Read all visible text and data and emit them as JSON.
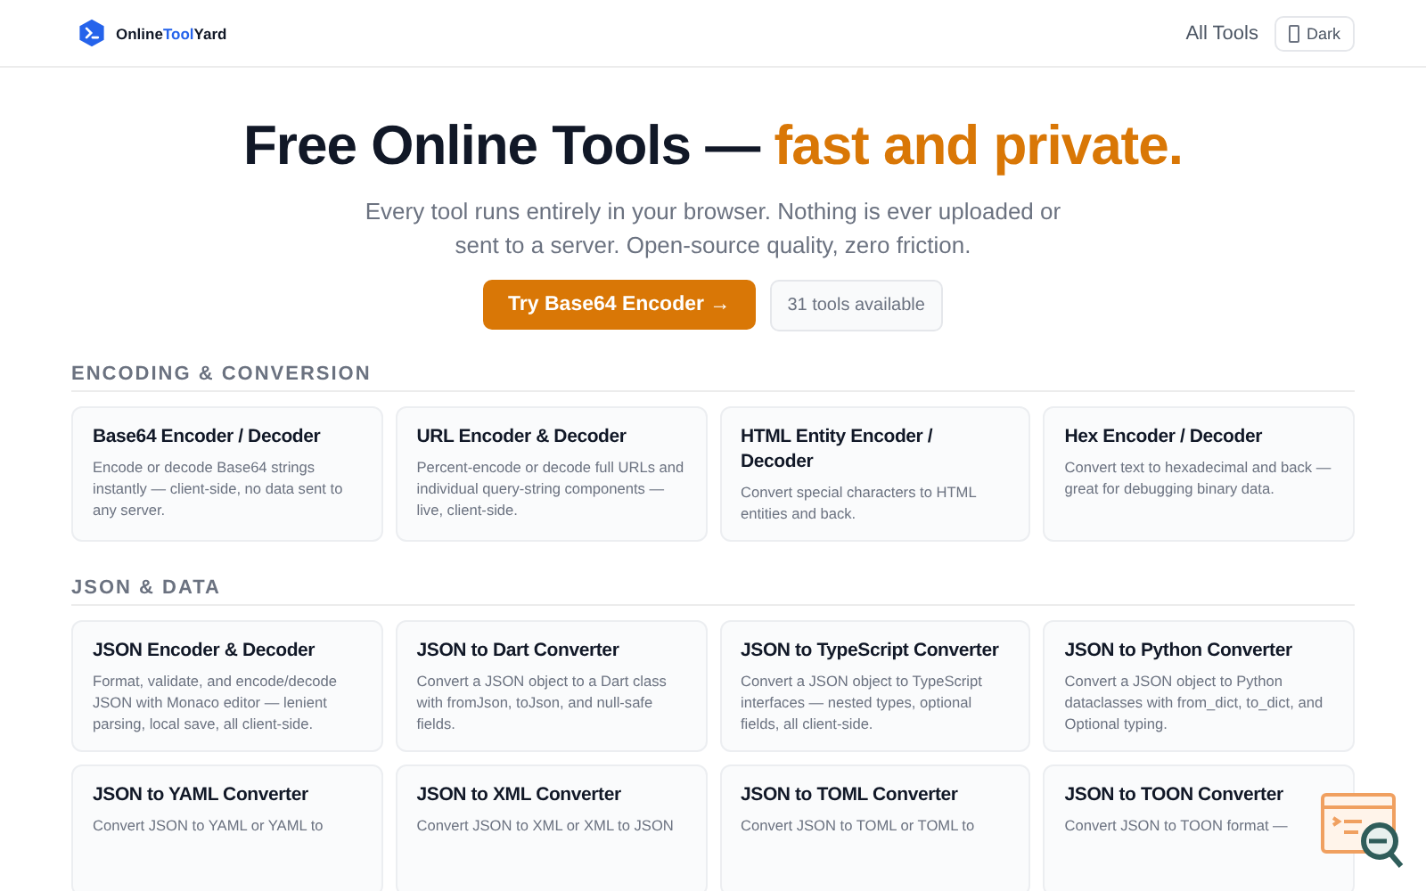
{
  "header": {
    "logo": {
      "name_start": "Online",
      "name_accent": "Tool",
      "name_end": "Yard"
    },
    "nav": [
      {
        "label": "All Tools"
      }
    ],
    "theme_button": {
      "label": "Dark"
    }
  },
  "hero": {
    "title": "Free Online Tools — ",
    "title_accent": "fast and private.",
    "subtitle": "Every tool runs entirely in your browser. Nothing is ever uploaded or sent to a server. Open-source quality, zero friction.",
    "primary_button": "Try Base64 Encoder →",
    "count_badge": "31 tools available"
  },
  "sections": [
    {
      "title": "ENCODING & CONVERSION",
      "tools": [
        {
          "name": "Base64 Encoder / Decoder",
          "description": "Encode or decode Base64 strings instantly — client-side, no data sent to any server."
        },
        {
          "name": "URL Encoder & Decoder",
          "description": "Percent-encode or decode full URLs and individual query-string components — live, client-side."
        },
        {
          "name": "HTML Entity Encoder / Decoder",
          "description": "Convert special characters to HTML entities and back."
        },
        {
          "name": "Hex Encoder / Decoder",
          "description": "Convert text to hexadecimal and back — great for debugging binary data."
        }
      ]
    },
    {
      "title": "JSON & DATA",
      "tools": [
        {
          "name": "JSON Encoder & Decoder",
          "description": "Format, validate, and encode/decode JSON with Monaco editor — lenient parsing, local save, all client-side."
        },
        {
          "name": "JSON to Dart Converter",
          "description": "Convert a JSON object to a Dart class with fromJson, toJson, and null-safe fields."
        },
        {
          "name": "JSON to TypeScript Converter",
          "description": "Convert a JSON object to TypeScript interfaces — nested types, optional fields, all client-side."
        },
        {
          "name": "JSON to Python Converter",
          "description": "Convert a JSON object to Python dataclasses with from_dict, to_dict, and Optional typing."
        },
        {
          "name": "JSON to YAML Converter",
          "description": "Convert JSON to YAML or YAML to"
        },
        {
          "name": "JSON to XML Converter",
          "description": "Convert JSON to XML or XML to JSON"
        },
        {
          "name": "JSON to TOML Converter",
          "description": "Convert JSON to TOML or TOML to"
        },
        {
          "name": "JSON to TOON Converter",
          "description": "Convert JSON to TOON format —"
        }
      ]
    }
  ]
}
